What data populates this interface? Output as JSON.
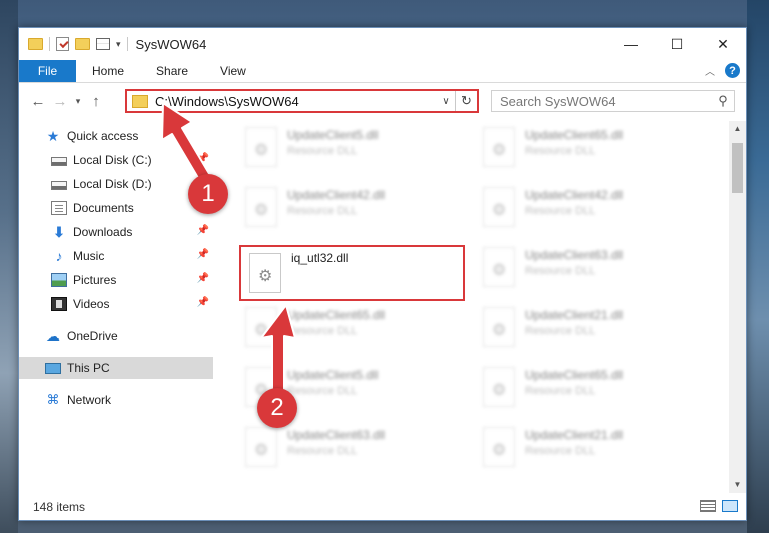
{
  "window": {
    "title": "SysWOW64"
  },
  "ribbon": {
    "tabs": [
      "File",
      "Home",
      "Share",
      "View"
    ]
  },
  "address": {
    "path": "C:\\Windows\\SysWOW64",
    "search_placeholder": "Search SysWOW64"
  },
  "sidebar": {
    "items": [
      {
        "label": "Quick access",
        "icon": "star-icon"
      },
      {
        "label": "Local Disk (C:)",
        "icon": "drive-icon",
        "pinned": true
      },
      {
        "label": "Local Disk (D:)",
        "icon": "drive-icon"
      },
      {
        "label": "Documents",
        "icon": "document-icon",
        "pinned": true
      },
      {
        "label": "Downloads",
        "icon": "download-icon",
        "pinned": true
      },
      {
        "label": "Music",
        "icon": "music-icon",
        "pinned": true
      },
      {
        "label": "Pictures",
        "icon": "pictures-icon",
        "pinned": true
      },
      {
        "label": "Videos",
        "icon": "videos-icon",
        "pinned": true
      },
      {
        "label": "OneDrive",
        "icon": "cloud-icon"
      },
      {
        "label": "This PC",
        "icon": "computer-icon",
        "selected": true
      },
      {
        "label": "Network",
        "icon": "network-icon"
      }
    ]
  },
  "files": {
    "left_column": [
      {
        "name": "UpdateClient5.dll",
        "type": "Resource DLL"
      },
      {
        "name": "UpdateClient42.dll",
        "type": "Resource DLL"
      },
      {
        "name": "iq_utl32.dll",
        "type": ""
      },
      {
        "name": "UpdateClient65.dll",
        "type": "Resource DLL"
      },
      {
        "name": "UpdateClient5.dll",
        "type": "Resource DLL"
      },
      {
        "name": "UpdateClient63.dll",
        "type": "Resource DLL"
      }
    ],
    "right_column": [
      {
        "name": "UpdateClient65.dll",
        "type": "Resource DLL"
      },
      {
        "name": "UpdateClient42.dll",
        "type": "Resource DLL"
      },
      {
        "name": "UpdateClient63.dll",
        "type": "Resource DLL"
      },
      {
        "name": "UpdateClient21.dll",
        "type": "Resource DLL"
      },
      {
        "name": "UpdateClient65.dll",
        "type": "Resource DLL"
      },
      {
        "name": "UpdateClient21.dll",
        "type": "Resource DLL"
      }
    ]
  },
  "status": {
    "item_count": "148 items"
  },
  "annotations": {
    "step1": "1",
    "step2": "2",
    "color": "#d9383a"
  }
}
